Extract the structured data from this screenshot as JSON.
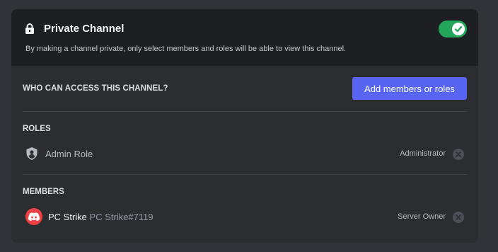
{
  "private_channel": {
    "title": "Private Channel",
    "description": "By making a channel private, only select members and roles will be able to view this channel.",
    "toggle_on": true
  },
  "access": {
    "label": "WHO CAN ACCESS THIS CHANNEL?",
    "add_button": "Add members or roles"
  },
  "roles": {
    "label": "ROLES",
    "items": [
      {
        "name": "Admin Role",
        "right_text": "Administrator",
        "icon": "shield-user-icon"
      }
    ]
  },
  "members": {
    "label": "MEMBERS",
    "items": [
      {
        "name": "PC Strike",
        "tag": "PC Strike#7119",
        "right_text": "Server Owner",
        "icon": "discord-avatar"
      }
    ]
  },
  "colors": {
    "background": "#313338",
    "card": "#2b2d31",
    "header": "#1e1f22",
    "toggle_on": "#23a55a",
    "accent": "#5865f2",
    "avatar": "#ed4245"
  }
}
